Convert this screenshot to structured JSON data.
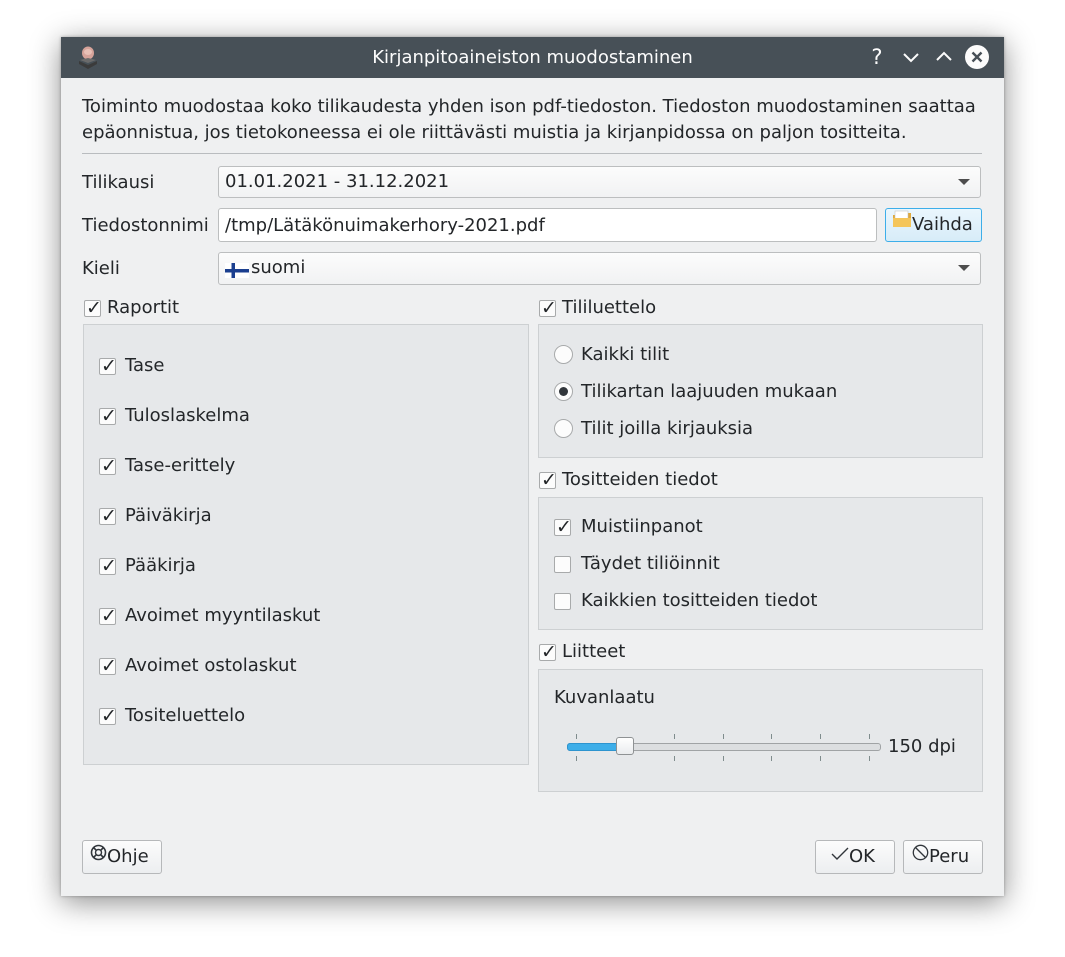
{
  "window": {
    "title": "Kirjanpitoaineiston muodostaminen",
    "help_button": "?"
  },
  "intro_text": "Toiminto muodostaa koko tilikaudesta yhden ison pdf-tiedoston. Tiedoston muodostaminen saattaa epäonnistua, jos tietokoneessa ei ole riittävästi muistia ja kirjanpidossa on paljon tositteita.",
  "form": {
    "tilikausi_label": "Tilikausi",
    "tilikausi_value": "01.01.2021 - 31.12.2021",
    "tiedostonnimi_label": "Tiedostonnimi",
    "tiedostonnimi_value": "/tmp/Lätäkönuimakerhory-2021.pdf",
    "vaihda_button": "Vaihda",
    "kieli_label": "Kieli",
    "kieli_value": "suomi"
  },
  "raportit": {
    "label": "Raportit",
    "checked": true,
    "items": [
      {
        "label": "Tase",
        "checked": true
      },
      {
        "label": "Tuloslaskelma",
        "checked": true
      },
      {
        "label": "Tase-erittely",
        "checked": true
      },
      {
        "label": "Päiväkirja",
        "checked": true
      },
      {
        "label": "Pääkirja",
        "checked": true
      },
      {
        "label": "Avoimet myyntilaskut",
        "checked": true
      },
      {
        "label": "Avoimet ostolaskut",
        "checked": true
      },
      {
        "label": "Tositeluettelo",
        "checked": true
      }
    ]
  },
  "tililuettelo": {
    "label": "Tililuettelo",
    "checked": true,
    "options": [
      {
        "label": "Kaikki tilit",
        "selected": false
      },
      {
        "label": "Tilikartan laajuuden mukaan",
        "selected": true
      },
      {
        "label": "Tilit joilla kirjauksia",
        "selected": false
      }
    ]
  },
  "tositteiden_tiedot": {
    "label": "Tositteiden tiedot",
    "checked": true,
    "items": [
      {
        "label": "Muistiinpanot",
        "checked": true
      },
      {
        "label": "Täydet tiliöinnit",
        "checked": false
      },
      {
        "label": "Kaikkien tositteiden tiedot",
        "checked": false
      }
    ]
  },
  "liitteet": {
    "label": "Liitteet",
    "checked": true,
    "quality_label": "Kuvanlaatu",
    "quality_value": "150 dpi",
    "slider_fraction": 0.2
  },
  "buttons": {
    "help": "Ohje",
    "ok": "OK",
    "cancel": "Peru"
  },
  "colors": {
    "titlebar": "#475057",
    "accent": "#3daee9",
    "window_bg": "#eff0f1"
  },
  "icons": [
    "app-logo-icon",
    "help-icon",
    "minimize-icon",
    "maximize-icon",
    "close-icon",
    "folder-icon",
    "finland-flag-icon",
    "lifebuoy-icon",
    "checkmark-icon",
    "cancel-circle-icon"
  ]
}
